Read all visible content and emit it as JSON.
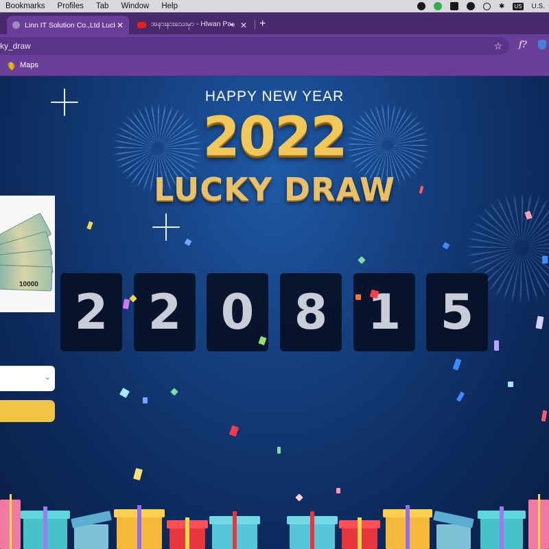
{
  "menubar": {
    "items": [
      "Bookmarks",
      "Profiles",
      "Tab",
      "Window",
      "Help"
    ],
    "tray": {
      "input_source": "U.S.",
      "flag_label": "US"
    }
  },
  "tabs": [
    {
      "title": "Linn IT Solution Co.,Ltd Lucky",
      "active": true,
      "icon": "globe-icon"
    },
    {
      "title": "အနားနားသေးမှာ - Hlwan Pa",
      "active": false,
      "icon": "youtube-icon",
      "audio": true
    }
  ],
  "toolbar": {
    "url": "ky_draw"
  },
  "bookmarks": [
    {
      "label": "Maps",
      "icon": "google-maps-icon"
    }
  ],
  "hero": {
    "greeting": "HAPPY NEW YEAR",
    "year": "2022",
    "title": "LUCKY DRAW"
  },
  "prize": {
    "amount": "10000"
  },
  "digits": [
    "2",
    "2",
    "0",
    "8",
    "1",
    "5"
  ],
  "colors": {
    "page_bg": "#0b2350",
    "digit_bg": "#071024",
    "gold": "#f1c75a",
    "button": "#f0c544",
    "browser": "#6a3f9a"
  }
}
